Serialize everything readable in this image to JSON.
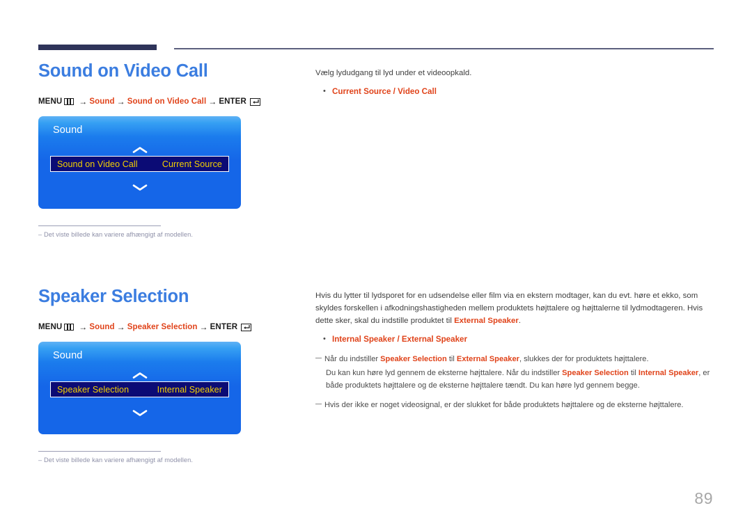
{
  "document": {
    "page_number": "89"
  },
  "icons": {
    "menu": "menu-icon",
    "enter": "enter-icon",
    "chevron_up": "chevron-up-icon",
    "chevron_down": "chevron-down-icon",
    "bullet": "bullet-dot-icon",
    "note_dash": "note-dash-icon"
  },
  "colors": {
    "heading": "#3b7de0",
    "accent_red": "#e0431a",
    "rule_navy": "#2e3359",
    "menu_blue": "#1566e8",
    "menu_highlight": "#0b0b75",
    "menu_highlight_text": "#f4d000",
    "footnote_gray": "#8e90a8",
    "page_number_gray": "#a7a7a7"
  },
  "sections": [
    {
      "heading": "Sound on Video Call",
      "path": {
        "menu_label": "MENU",
        "arrow": "→",
        "steps": [
          "Sound",
          "Sound on Video Call"
        ],
        "enter_label": "ENTER"
      },
      "tv_menu": {
        "title": "Sound",
        "row_label": "Sound on Video Call",
        "row_value": "Current Source"
      },
      "footnote": "Det viste billede kan variere afhængigt af modellen.",
      "footnote_marker": "–",
      "intro": "Vælg lydudgang til lyd under et videoopkald.",
      "options_bullet": {
        "first": "Current Source",
        "separator": " / ",
        "second": "Video Call"
      }
    },
    {
      "heading": "Speaker Selection",
      "path": {
        "menu_label": "MENU",
        "arrow": "→",
        "steps": [
          "Sound",
          "Speaker Selection"
        ],
        "enter_label": "ENTER"
      },
      "tv_menu": {
        "title": "Sound",
        "row_label": "Speaker Selection",
        "row_value": "Internal Speaker"
      },
      "footnote": "Det viste billede kan variere afhængigt af modellen.",
      "footnote_marker": "–",
      "paragraph": {
        "part1": "Hvis du lytter til lydsporet for en udsendelse eller film via en ekstern modtager, kan du evt. høre et ekko, som skyldes forskellen i afkodningshastigheden mellem produktets højttalere og højttalerne til lydmodtageren. Hvis dette sker, skal du indstille produktet til ",
        "highlight1": "External Speaker",
        "part2": "."
      },
      "options_bullet": {
        "first": "Internal Speaker",
        "separator": " / ",
        "second": "External Speaker"
      },
      "notes": [
        {
          "line1_a": "Når du indstiller ",
          "line1_h1": "Speaker Selection",
          "line1_b": " til ",
          "line1_h2": "External Speaker",
          "line1_c": ", slukkes der for produktets højttalere.",
          "line2_a": "Du kan kun høre lyd gennem de eksterne højttalere. Når du indstiller ",
          "line2_h1": "Speaker Selection",
          "line2_b": " til ",
          "line2_h2": "Internal Speaker",
          "line2_c": ", er både produktets højttalere og de eksterne højttalere tændt. Du kan høre lyd gennem begge."
        },
        {
          "line1_a": "Hvis der ikke er noget videosignal, er der slukket for både produktets højttalere og de eksterne højttalere.",
          "line1_h1": "",
          "line1_b": "",
          "line1_h2": "",
          "line1_c": "",
          "line2_a": "",
          "line2_h1": "",
          "line2_b": "",
          "line2_h2": "",
          "line2_c": ""
        }
      ]
    }
  ]
}
